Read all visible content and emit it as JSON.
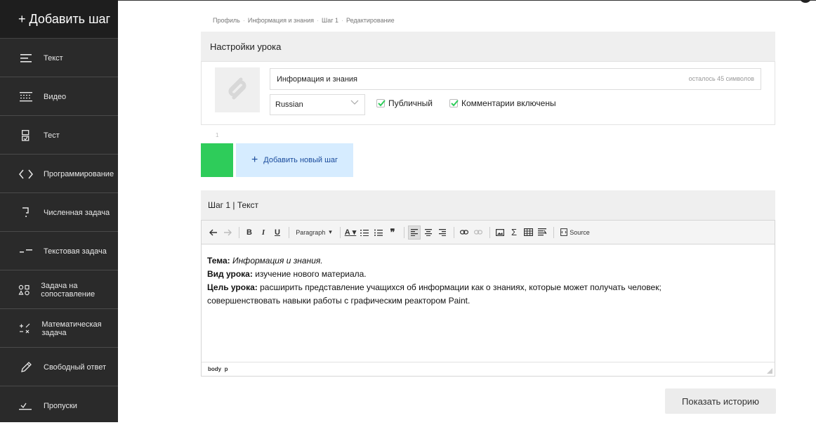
{
  "sidebar": {
    "add_step": "+ Добавить шаг",
    "items": [
      {
        "label": "Текст",
        "icon": "text-lines-icon"
      },
      {
        "label": "Видео",
        "icon": "video-icon"
      },
      {
        "label": "Тест",
        "icon": "quiz-icon"
      },
      {
        "label": "Программирование",
        "icon": "code-icon"
      },
      {
        "label": "Численная задача",
        "icon": "number-icon"
      },
      {
        "label": "Текстовая задача",
        "icon": "text-task-icon"
      },
      {
        "label": "Задача на сопоставление",
        "icon": "matching-icon"
      },
      {
        "label": "Математическая задача",
        "icon": "math-icon"
      },
      {
        "label": "Свободный ответ",
        "icon": "pencil-icon"
      },
      {
        "label": "Пропуски",
        "icon": "blanks-icon"
      }
    ]
  },
  "breadcrumb": [
    "Профиль",
    "Информация и знания",
    "Шаг 1",
    "Редактирование"
  ],
  "lesson_settings": {
    "header": "Настройки урока",
    "title_value": "Информация и знания",
    "chars_left": "осталось 45 символов",
    "language": "Russian",
    "public_label": "Публичный",
    "comments_label": "Комментарии включены"
  },
  "steps": {
    "step_number": "1",
    "add_new_step": "Добавить новый шаг"
  },
  "step_editor": {
    "header": "Шаг 1 | Текст",
    "toolbar": {
      "paragraph": "Paragraph",
      "source": "Source"
    },
    "content": {
      "topic_label": "Тема:",
      "topic_value": "Информация и знания.",
      "type_label": "Вид урока:",
      "type_value": "изучение нового материала.",
      "goal_label": "Цель урока:",
      "goal_value": "расширить представление учащихся об информации как о знаниях, которые может получать человек;",
      "goal_value_2": "совершенствовать навыки работы с графическим реактором Paint."
    },
    "path_body": "body",
    "path_p": "p"
  },
  "history_button": "Показать историю",
  "colors": {
    "sidebar_bg": "#2a2a2a",
    "accent_green": "#2ecc5a",
    "add_step_bg": "#d6ecff",
    "link_blue": "#1a4b9c"
  }
}
